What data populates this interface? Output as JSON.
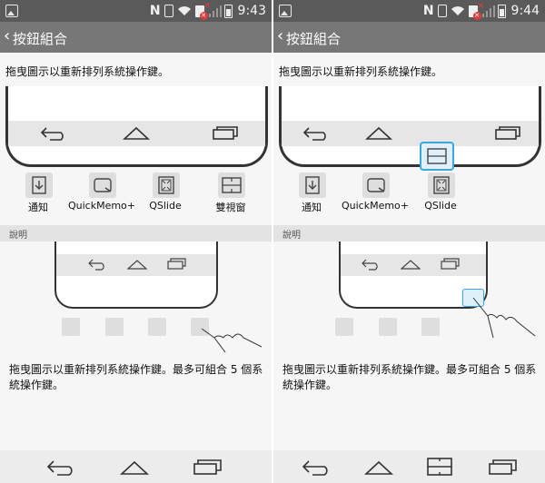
{
  "left": {
    "time": "9:43",
    "title": "按鈕組合",
    "drag_hint": "拖曳圖示以重新排列系統操作鍵。",
    "keys": [
      {
        "label": "通知",
        "icon": "notification-icon"
      },
      {
        "label": "QuickMemo+",
        "icon": "quickmemo-icon"
      },
      {
        "label": "QSlide",
        "icon": "qslide-icon"
      },
      {
        "label": "雙視窗",
        "icon": "dual-window-icon"
      }
    ],
    "section_header": "說明",
    "description": "拖曳圖示以重新排列系統操作鍵。最多可組合 5 個系統操作鍵。"
  },
  "right": {
    "time": "9:44",
    "title": "按鈕組合",
    "drag_hint": "拖曳圖示以重新排列系統操作鍵。",
    "keys": [
      {
        "label": "通知",
        "icon": "notification-icon"
      },
      {
        "label": "QuickMemo+",
        "icon": "quickmemo-icon"
      },
      {
        "label": "QSlide",
        "icon": "qslide-icon"
      }
    ],
    "section_header": "說明",
    "description": "拖曳圖示以重新排列系統操作鍵。最多可組合 5 個系統操作鍵。"
  },
  "colors": {
    "status_bar": "#5a5a5a",
    "app_bar": "#777777",
    "highlight": "#3aa7e0",
    "error": "#e23b3b"
  }
}
